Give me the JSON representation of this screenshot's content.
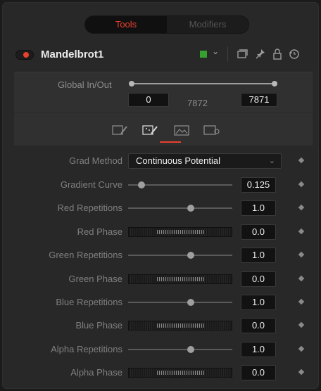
{
  "tabs": [
    {
      "label": "Tools",
      "active": true
    },
    {
      "label": "Modifiers",
      "active": false
    }
  ],
  "node": {
    "title": "Mandelbrot1",
    "color": "#35a12f",
    "chevron": "⌄",
    "icons": [
      "window-icon",
      "pin-icon",
      "lock-icon",
      "reset-icon"
    ]
  },
  "global": {
    "label": "Global In/Out",
    "in_value": "0",
    "mid_value": "7872",
    "out_value": "7871"
  },
  "pages": [
    "controls-page-icon",
    "color-page-icon",
    "image-page-icon",
    "settings-page-icon"
  ],
  "grad_method": {
    "label": "Grad Method",
    "value": "Continuous Potential",
    "chevron": "⌄"
  },
  "params": [
    {
      "label": "Gradient Curve",
      "type": "slider",
      "value": "0.125",
      "fraction": 0.125
    },
    {
      "label": "Red Repetitions",
      "type": "slider",
      "value": "1.0",
      "fraction": 0.6
    },
    {
      "label": "Red Phase",
      "type": "phase",
      "value": "0.0"
    },
    {
      "label": "Green Repetitions",
      "type": "slider",
      "value": "1.0",
      "fraction": 0.6
    },
    {
      "label": "Green Phase",
      "type": "phase",
      "value": "0.0"
    },
    {
      "label": "Blue Repetitions",
      "type": "slider",
      "value": "1.0",
      "fraction": 0.6
    },
    {
      "label": "Blue Phase",
      "type": "phase",
      "value": "0.0"
    },
    {
      "label": "Alpha Repetitions",
      "type": "slider",
      "value": "1.0",
      "fraction": 0.6
    },
    {
      "label": "Alpha Phase",
      "type": "phase",
      "value": "0.0"
    }
  ],
  "colors": {
    "accent": "#e8402e",
    "panel": "#303030",
    "background": "#282828"
  }
}
